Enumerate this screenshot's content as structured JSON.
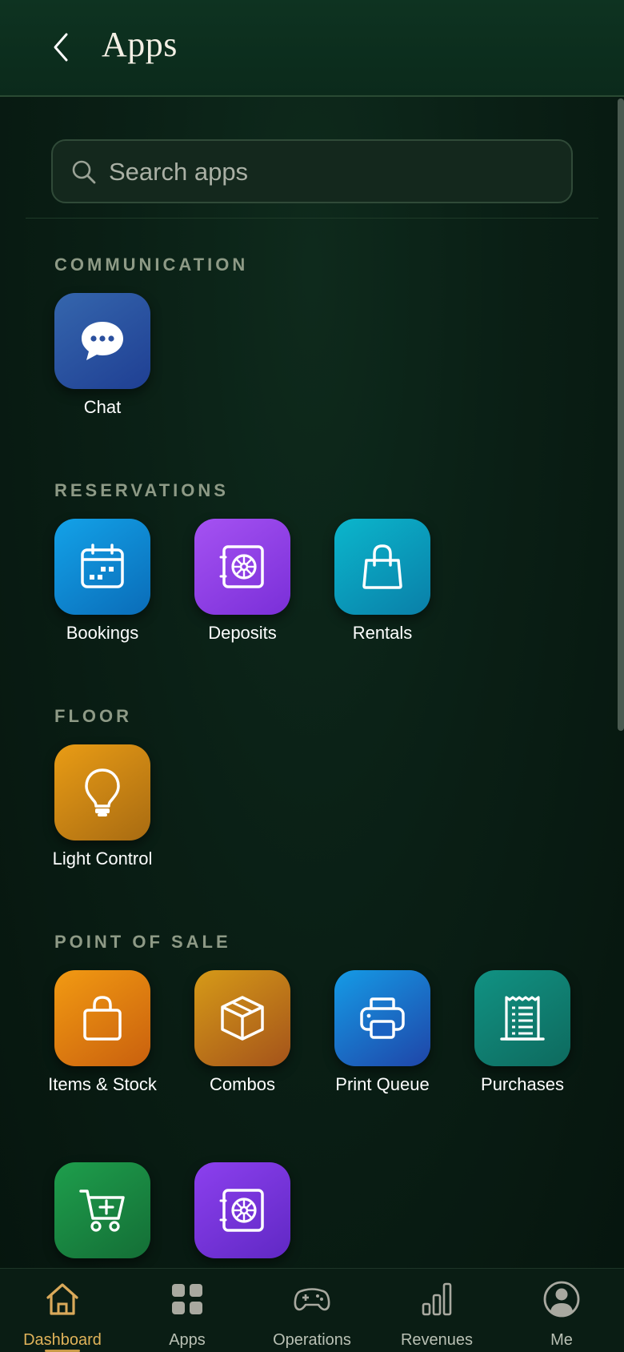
{
  "header": {
    "title": "Apps"
  },
  "search": {
    "placeholder": "Search apps"
  },
  "sections": [
    {
      "title": "COMMUNICATION",
      "apps": [
        {
          "label": "Chat",
          "icon": "chat-bubble-icon"
        }
      ]
    },
    {
      "title": "RESERVATIONS",
      "apps": [
        {
          "label": "Bookings",
          "icon": "calendar-icon"
        },
        {
          "label": "Deposits",
          "icon": "safe-icon"
        },
        {
          "label": "Rentals",
          "icon": "shopping-bag-icon"
        }
      ]
    },
    {
      "title": "FLOOR",
      "apps": [
        {
          "label": "Light Control",
          "icon": "lightbulb-icon"
        }
      ]
    },
    {
      "title": "POINT OF SALE",
      "apps": [
        {
          "label": "Items & Stock",
          "icon": "bag-icon"
        },
        {
          "label": "Combos",
          "icon": "box-icon"
        },
        {
          "label": "Print Queue",
          "icon": "printer-icon"
        },
        {
          "label": "Purchases",
          "icon": "receipt-icon"
        },
        {
          "label": "",
          "icon": "cart-add-icon"
        },
        {
          "label": "",
          "icon": "safe-icon"
        }
      ]
    }
  ],
  "nav": [
    {
      "label": "Dashboard",
      "icon": "home-icon",
      "active": true
    },
    {
      "label": "Apps",
      "icon": "grid-icon"
    },
    {
      "label": "Operations",
      "icon": "gamepad-icon"
    },
    {
      "label": "Revenues",
      "icon": "bar-chart-icon"
    },
    {
      "label": "Me",
      "icon": "user-circle-icon"
    }
  ],
  "colors": {
    "background": "#0a1f15",
    "accent": "#e0b35a",
    "section_title": "#8e9a86",
    "chat_tile": "#2a5aa8",
    "bookings_tile": "#0d8fd6",
    "deposits_tile": "#8b3fe0",
    "rentals_tile": "#0aa3bf",
    "light_tile": "#d9900f",
    "items_tile": "#e07f0d",
    "combos_tile": "#c77d14",
    "print_tile": "#1a6fd0",
    "purchases_tile": "#0f7f70",
    "cart_tile": "#1b8a42",
    "safe2_tile": "#7a35d8"
  }
}
